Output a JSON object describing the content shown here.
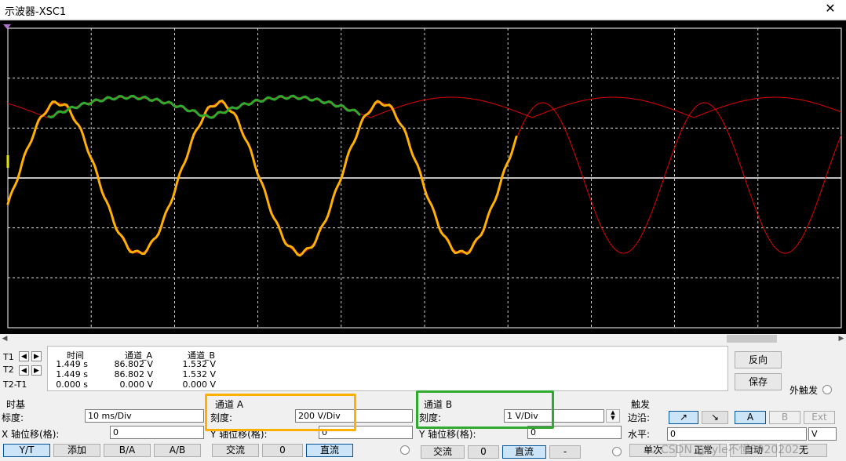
{
  "window": {
    "title": "示波器-XSC1",
    "close_glyph": "✕"
  },
  "colors": {
    "screen_bg": "#000000",
    "grid": "#ffffff",
    "channel_a": "#e00000",
    "channel_b": "#22aa22",
    "annotation_orange": "#ffb000",
    "annotation_green": "#2eaa2e",
    "cursor_t1": "#e6e600"
  },
  "cursors": {
    "rows": [
      {
        "label": "T1",
        "time": "1.449 s",
        "ch_a": "86.802 V",
        "ch_b": "1.532 V"
      },
      {
        "label": "T2",
        "time": "1.449 s",
        "ch_a": "86.802 V",
        "ch_b": "1.532 V"
      },
      {
        "label": "T2-T1",
        "time": "0.000 s",
        "ch_a": "0.000 V",
        "ch_b": "0.000 V"
      }
    ],
    "headers": {
      "time": "时间",
      "ch_a": "通道_A",
      "ch_b": "通道_B"
    },
    "reverse_label": "反向",
    "save_label": "保存",
    "external_trigger_label": "外触发"
  },
  "timebase": {
    "title": "时基",
    "scale_label": "标度:",
    "scale_value": "10 ms/Div",
    "x_offset_label": "X 轴位移(格):",
    "x_offset_value": "0",
    "modes": [
      "Y/T",
      "添加",
      "B/A",
      "A/B"
    ],
    "active_mode": "Y/T"
  },
  "channel_a": {
    "title": "通道 A",
    "scale_label": "刻度:",
    "scale_value": "200  V/Div",
    "y_offset_label": "Y 轴位移(格):",
    "y_offset_value": "0",
    "coupling": [
      "交流",
      "0",
      "直流"
    ],
    "active_coupling": "直流"
  },
  "channel_b": {
    "title": "通道 B",
    "scale_label": "刻度:",
    "scale_value": "1  V/Div",
    "y_offset_label": "Y 轴位移(格):",
    "y_offset_value": "0",
    "coupling": [
      "交流",
      "0",
      "直流",
      "-"
    ],
    "active_coupling": "直流"
  },
  "trigger": {
    "title": "触发",
    "edge_label": "边沿:",
    "edge_buttons": [
      "↗",
      "↘"
    ],
    "source_buttons": [
      "A",
      "B",
      "Ext"
    ],
    "active_source": "A",
    "level_label": "水平:",
    "level_value": "0",
    "level_unit": "V",
    "modes": [
      "单次",
      "正常",
      "自动",
      "无"
    ]
  },
  "watermark": "CSDN @Lyle不懂3020202"
}
